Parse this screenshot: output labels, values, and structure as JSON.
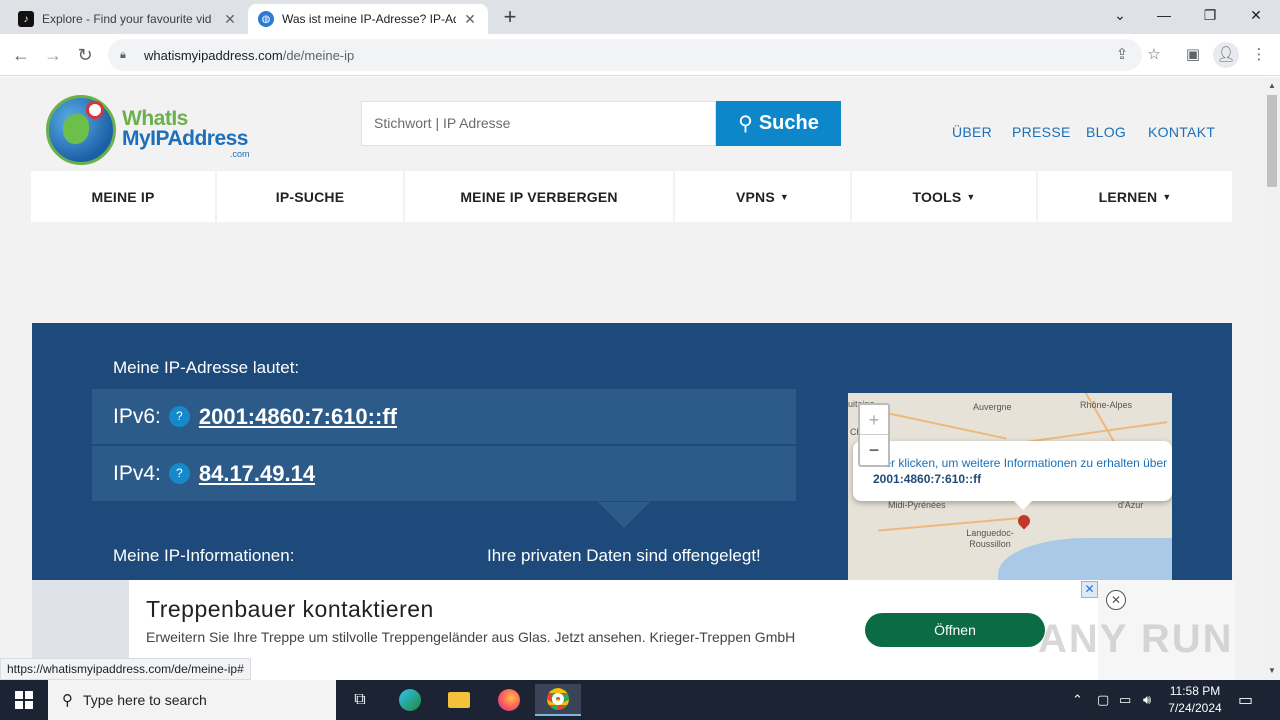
{
  "browser": {
    "tabs": [
      {
        "title": "Explore - Find your favourite vid",
        "favicon": "tiktok-icon"
      },
      {
        "title": "Was ist meine IP-Adresse? IP-Ad",
        "favicon": "globe-icon"
      }
    ],
    "url_host": "whatismyipaddress.com",
    "url_path": "/de/meine-ip",
    "status_url": "https://whatismyipaddress.com/de/meine-ip#"
  },
  "site": {
    "logo_line1": "WhatIs",
    "logo_line2": "MyIPAddress",
    "logo_line3": ".com",
    "search_placeholder": "Stichwort | IP Adresse",
    "search_button": "Suche",
    "top_links": [
      "ÜBER",
      "PRESSE",
      "BLOG",
      "KONTAKT"
    ],
    "nav": [
      {
        "label": "MEINE IP",
        "caret": ""
      },
      {
        "label": "IP-SUCHE",
        "caret": ""
      },
      {
        "label": "MEINE IP VERBERGEN",
        "caret": ""
      },
      {
        "label": "VPNS",
        "caret": "▼"
      },
      {
        "label": "TOOLS",
        "caret": "▼"
      },
      {
        "label": "LERNEN",
        "caret": "▼"
      }
    ]
  },
  "hero": {
    "title": "Meine IP-Adresse lautet:",
    "ipv6_label": "IPv6:",
    "ipv6_value": "2001:4860:7:610::ff",
    "ipv4_label": "IPv4:",
    "ipv4_value": "84.17.49.14",
    "help": "?",
    "info_title": "Meine IP-Informationen:",
    "privacy_warning": "Ihre privaten Daten sind offengelegt!"
  },
  "map": {
    "zoom_in": "+",
    "zoom_out": "−",
    "popup_text": "Hier klicken, um weitere Informationen zu erhalten über",
    "popup_ip": "2001:4860:7:610::ff",
    "labels": [
      "Auvergne",
      "Rhône-Alpes",
      "Midi-Pyrénées",
      "Languedoc-Roussillon",
      "d'Azur",
      "uitaine",
      "Ch"
    ]
  },
  "ad": {
    "title": "Treppenbauer kontaktieren",
    "description": "Erweitern Sie Ihre Treppe um stilvolle Treppengeländer aus Glas. Jetzt ansehen. Krieger-Treppen GmbH",
    "button": "Öffnen",
    "close": "✕",
    "x": "✕"
  },
  "watermark": "ANY RUN",
  "taskbar": {
    "search_placeholder": "Type here to search",
    "time": "11:58 PM",
    "date": "7/24/2024"
  }
}
